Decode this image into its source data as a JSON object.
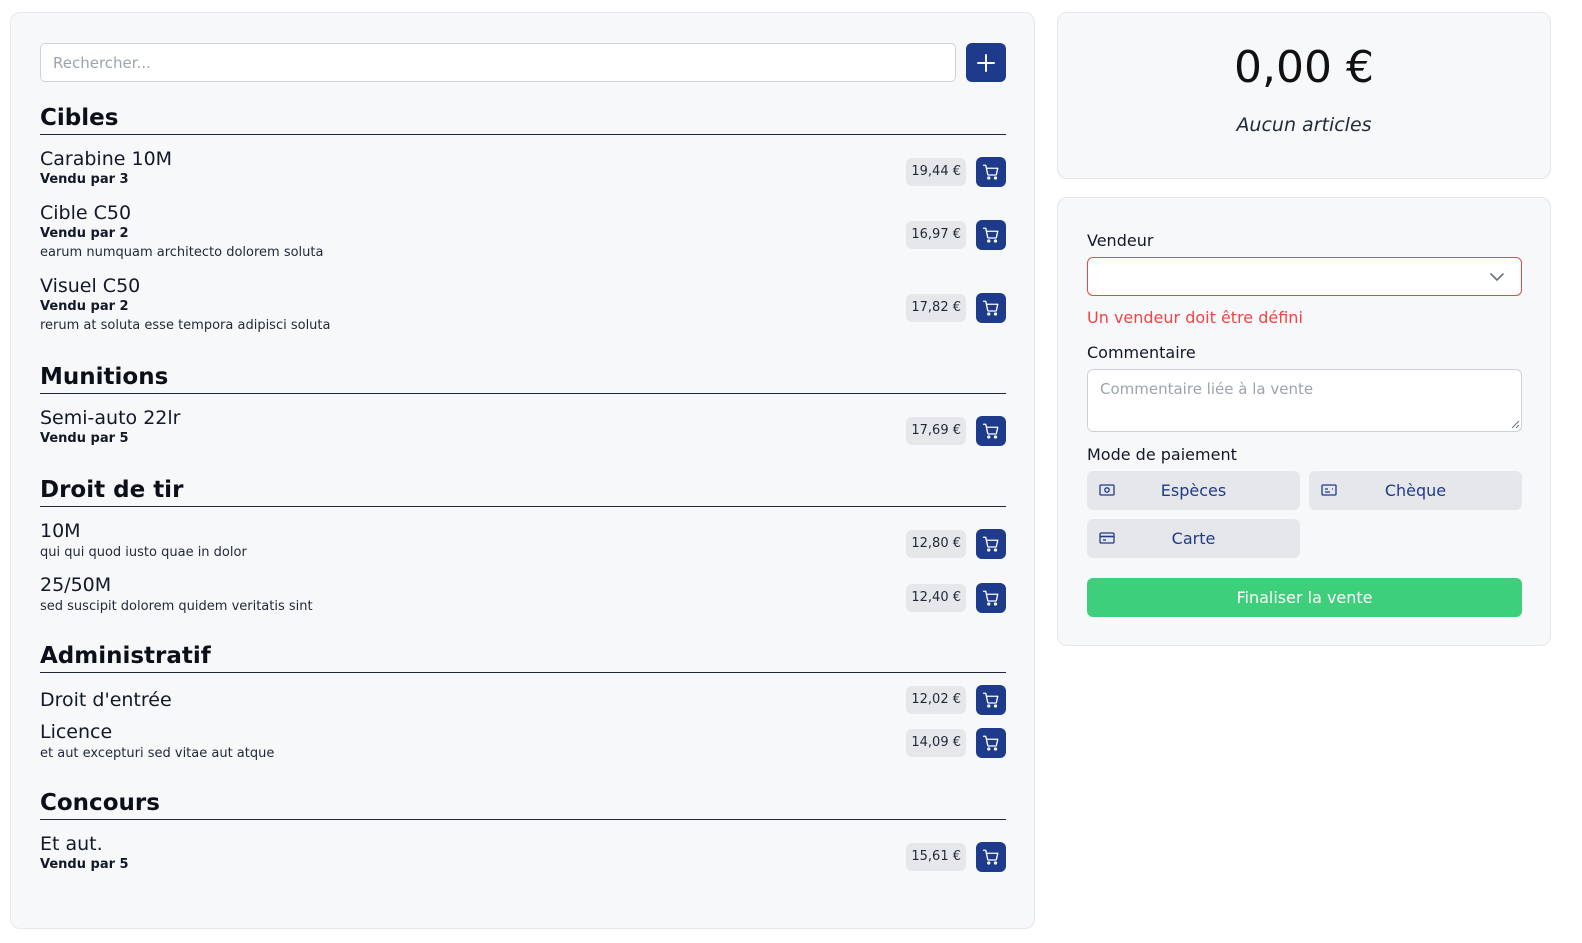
{
  "search": {
    "placeholder": "Rechercher..."
  },
  "categories": [
    {
      "title": "Cibles",
      "items": [
        {
          "name": "Carabine 10M",
          "sold": "Vendu par 3",
          "price": "19,44 €"
        },
        {
          "name": "Cible C50",
          "sold": "Vendu par 2",
          "desc": "earum numquam architecto dolorem soluta",
          "price": "16,97 €"
        },
        {
          "name": "Visuel C50",
          "sold": "Vendu par 2",
          "desc": "rerum at soluta esse tempora adipisci soluta",
          "price": "17,82 €"
        }
      ]
    },
    {
      "title": "Munitions",
      "items": [
        {
          "name": "Semi-auto 22lr",
          "sold": "Vendu par 5",
          "price": "17,69 €"
        }
      ]
    },
    {
      "title": "Droit de tir",
      "items": [
        {
          "name": "10M",
          "desc": "qui qui quod iusto quae in dolor",
          "price": "12,80 €"
        },
        {
          "name": "25/50M",
          "desc": "sed suscipit dolorem quidem veritatis sint",
          "price": "12,40 €"
        }
      ]
    },
    {
      "title": "Administratif",
      "items": [
        {
          "name": "Droit d'entrée",
          "price": "12,02 €"
        },
        {
          "name": "Licence",
          "desc": "et aut excepturi sed vitae aut atque",
          "price": "14,09 €"
        }
      ]
    },
    {
      "title": "Concours",
      "items": [
        {
          "name": "Et aut.",
          "sold": "Vendu par 5",
          "price": "15,61 €"
        }
      ]
    }
  ],
  "summary": {
    "total": "0,00 €",
    "count_label": "Aucun articles"
  },
  "form": {
    "seller_label": "Vendeur",
    "seller_value": "",
    "seller_error": "Un vendeur doit être défini",
    "comment_label": "Commentaire",
    "comment_placeholder": "Commentaire liée à la vente",
    "payment_label": "Mode de paiement",
    "payment_methods": [
      {
        "label": "Espèces",
        "icon": "cash-icon"
      },
      {
        "label": "Chèque",
        "icon": "cheque-icon"
      },
      {
        "label": "Carte",
        "icon": "credit-card-icon"
      }
    ],
    "finalize_label": "Finaliser la vente"
  },
  "colors": {
    "primary": "#1e3a8a",
    "error": "#ef4444",
    "success": "#3ecf7a",
    "chip": "#e5e7eb",
    "panel": "#f7f8fa"
  }
}
